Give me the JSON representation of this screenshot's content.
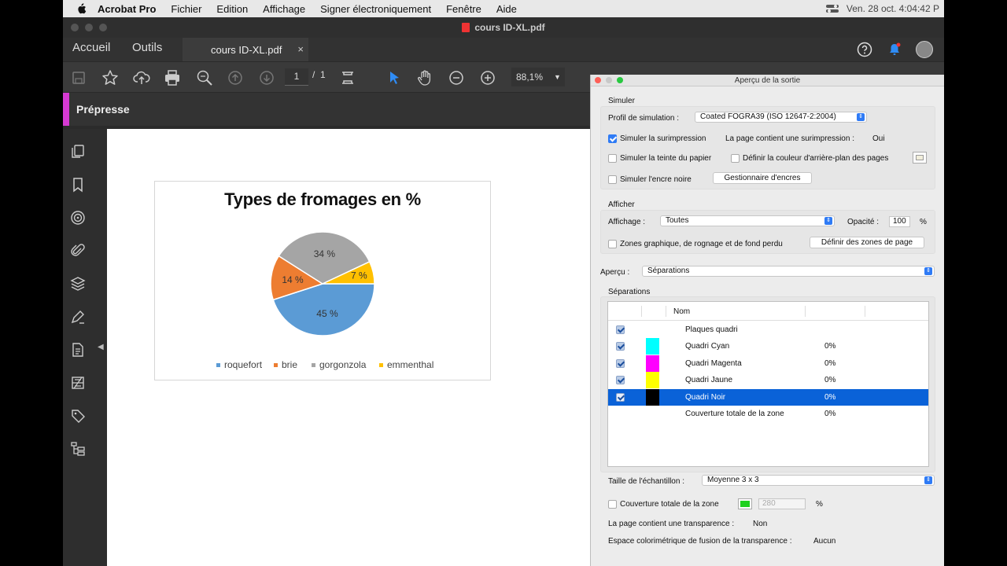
{
  "menubar": {
    "app": "Acrobat Pro",
    "items": [
      "Fichier",
      "Edition",
      "Affichage",
      "Signer électroniquement",
      "Fenêtre",
      "Aide"
    ],
    "clock": "Ven. 28 oct.  4:04:42 P"
  },
  "window": {
    "title": "cours ID-XL.pdf"
  },
  "tabs": {
    "home": "Accueil",
    "tools": "Outils",
    "doc": "cours ID-XL.pdf",
    "close": "×"
  },
  "toolbar": {
    "page_current": "1",
    "page_sep": "/",
    "page_total": "1",
    "zoom": "88,1%"
  },
  "tool_panel": {
    "label": "Prépresse"
  },
  "chart_data": {
    "type": "pie",
    "title": "Types de fromages en %",
    "categories": [
      "roquefort",
      "brie",
      "gorgonzola",
      "emmenthal"
    ],
    "values": [
      45,
      14,
      34,
      7
    ],
    "labels": [
      "45 %",
      "14 %",
      "34 %",
      "7 %"
    ],
    "colors": [
      "#5b9bd5",
      "#ed7d31",
      "#a5a5a5",
      "#ffc000"
    ],
    "legend": "bottom"
  },
  "output_preview": {
    "title": "Aperçu de la sortie",
    "simulate": {
      "heading": "Simuler",
      "profile_label": "Profil de simulation :",
      "profile_value": "Coated FOGRA39 (ISO 12647-2:2004)",
      "overprint_label": "Simuler la surimpression",
      "overprint_page_label": "La page contient une surimpression :",
      "overprint_page_value": "Oui",
      "paper_label": "Simuler la teinte du papier",
      "bg_label": "Définir la couleur d'arrière-plan des pages",
      "black_label": "Simuler l'encre noire",
      "ink_button": "Gestionnaire d'encres"
    },
    "show": {
      "heading": "Afficher",
      "display_label": "Affichage :",
      "display_value": "Toutes",
      "opacity_label": "Opacité :",
      "opacity_value": "100",
      "opacity_unit": "%",
      "zones_label": "Zones graphique, de rognage et de fond perdu",
      "zones_button": "Définir des zones de page"
    },
    "preview_label": "Aperçu :",
    "preview_value": "Séparations",
    "separations": {
      "heading": "Séparations",
      "col_name": "Nom",
      "rows": [
        {
          "name": "Plaques quadri",
          "pct": "",
          "color": ""
        },
        {
          "name": "Quadri Cyan",
          "pct": "0%",
          "color": "#00ffff"
        },
        {
          "name": "Quadri Magenta",
          "pct": "0%",
          "color": "#ff00ff"
        },
        {
          "name": "Quadri Jaune",
          "pct": "0%",
          "color": "#ffff00"
        },
        {
          "name": "Quadri Noir",
          "pct": "0%",
          "color": "#000000"
        },
        {
          "name": "Couverture totale de la zone",
          "pct": "0%",
          "color": ""
        }
      ]
    },
    "sample_label": "Taille de l'échantillon :",
    "sample_value": "Moyenne 3 x 3",
    "coverage_label": "Couverture totale de la zone",
    "coverage_value": "280",
    "coverage_unit": "%",
    "transparency_label": "La page contient une transparence :",
    "transparency_value": "Non",
    "blend_label": "Espace colorimétrique de fusion de la transparence :",
    "blend_value": "Aucun"
  }
}
